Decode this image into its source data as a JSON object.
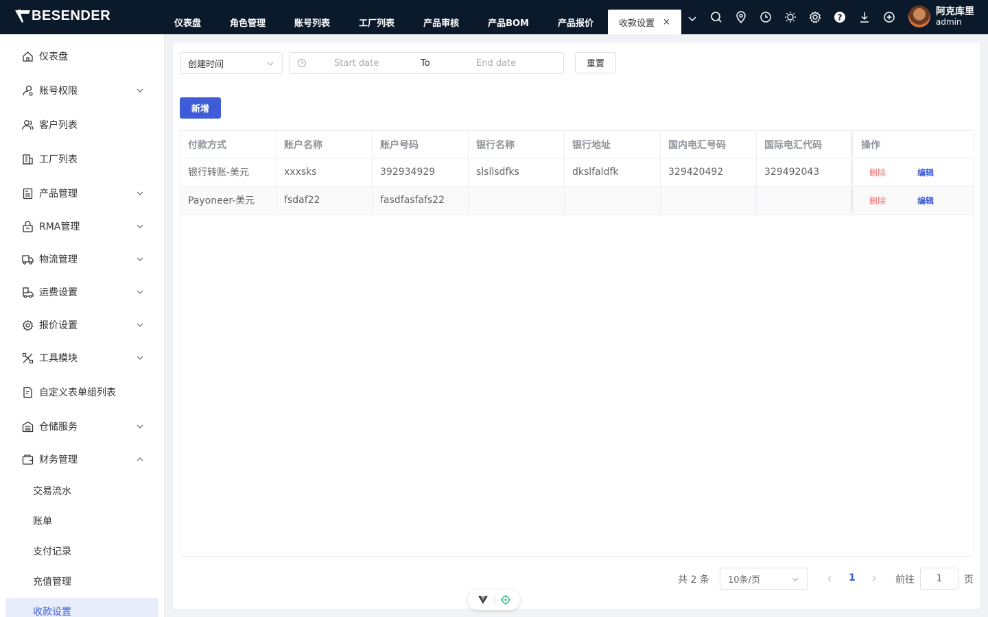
{
  "app": {
    "brand": "BESENDER"
  },
  "topnav": {
    "tabs": [
      "仪表盘",
      "角色管理",
      "账号列表",
      "工厂列表",
      "产品审核",
      "产品BOM",
      "产品报价"
    ],
    "active_tab": "收款设置",
    "close_symbol": "×"
  },
  "toolbar_icons": [
    "search-icon",
    "location-icon",
    "clock-icon",
    "sun-icon",
    "gear-icon",
    "help-icon",
    "download-icon",
    "plus-circle-icon"
  ],
  "user": {
    "name": "阿克库里",
    "role": "admin"
  },
  "sidebar": {
    "items": [
      {
        "label": "仪表盘",
        "icon": "home-icon",
        "expandable": false
      },
      {
        "label": "账号权限",
        "icon": "user-key-icon",
        "expandable": true
      },
      {
        "label": "客户列表",
        "icon": "users-icon",
        "expandable": false
      },
      {
        "label": "工厂列表",
        "icon": "building-icon",
        "expandable": false
      },
      {
        "label": "产品管理",
        "icon": "box-icon",
        "expandable": true
      },
      {
        "label": "RMA管理",
        "icon": "lock-box-icon",
        "expandable": true
      },
      {
        "label": "物流管理",
        "icon": "truck-icon",
        "expandable": true
      },
      {
        "label": "运费设置",
        "icon": "shipping-icon",
        "expandable": true
      },
      {
        "label": "报价设置",
        "icon": "gear-icon",
        "expandable": true
      },
      {
        "label": "工具模块",
        "icon": "tools-icon",
        "expandable": true
      },
      {
        "label": "自定义表单组列表",
        "icon": "form-icon",
        "expandable": false
      },
      {
        "label": "仓储服务",
        "icon": "warehouse-icon",
        "expandable": true
      },
      {
        "label": "财务管理",
        "icon": "wallet-icon",
        "expandable": true,
        "expanded": true
      }
    ],
    "finance_children": [
      "交易流水",
      "账单",
      "支付记录",
      "充值管理",
      "收款设置"
    ],
    "active_child": "收款设置"
  },
  "filters": {
    "field_select": "创建时间",
    "start_placeholder": "Start date",
    "range_separator": "To",
    "end_placeholder": "End date",
    "reset_label": "重置"
  },
  "actions": {
    "add_label": "新增"
  },
  "table": {
    "columns": [
      "付款方式",
      "账户名称",
      "账户号码",
      "银行名称",
      "银行地址",
      "国内电汇号码",
      "国际电汇代码",
      "操作"
    ],
    "rows": [
      {
        "cells": [
          "银行转账-美元",
          "xxxsks",
          "392934929",
          "slsllsdfks",
          "dkslfaldfk",
          "329420492",
          "329492043"
        ],
        "delete": "删除",
        "edit": "编辑"
      },
      {
        "cells": [
          "Payoneer-美元",
          "fsdaf22",
          "fasdfasfafs22",
          "",
          "",
          "",
          ""
        ],
        "delete": "删除",
        "edit": "编辑"
      }
    ]
  },
  "pagination": {
    "total_text": "共 2 条",
    "page_size": "10条/页",
    "current_page": "1",
    "goto_label": "前往",
    "goto_value": "1",
    "page_unit": "页"
  },
  "colors": {
    "topbar": "#0b1a2b",
    "primary": "#3e5bd8",
    "danger": "#f56c6c",
    "active_bg": "#e8edfb"
  }
}
